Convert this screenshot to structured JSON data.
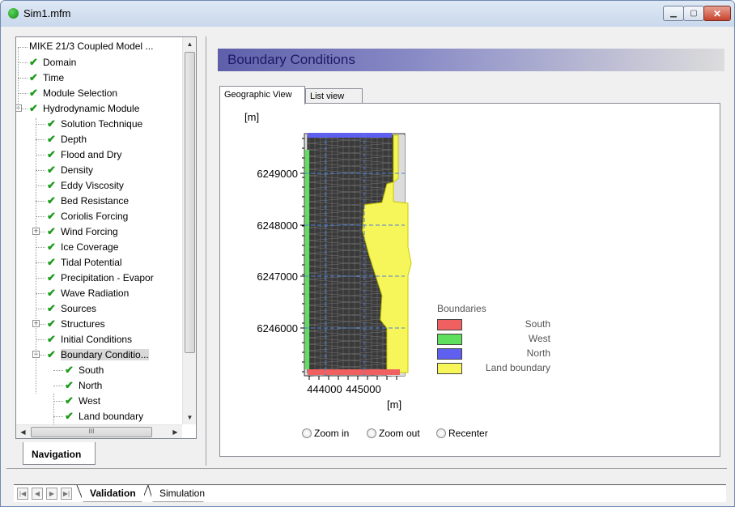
{
  "window": {
    "title": "Sim1.mfm",
    "min": "▁",
    "max": "▢",
    "close": "✕"
  },
  "tree": {
    "items": [
      {
        "label": "MIKE 21/3 Coupled Model ...",
        "level": 0,
        "check": false
      },
      {
        "label": "Domain",
        "level": 0,
        "check": true
      },
      {
        "label": "Time",
        "level": 0,
        "check": true
      },
      {
        "label": "Module Selection",
        "level": 0,
        "check": true
      },
      {
        "label": "Hydrodynamic Module",
        "level": 0,
        "check": true,
        "expander": "−"
      },
      {
        "label": "Solution Technique",
        "level": 1,
        "check": true
      },
      {
        "label": "Depth",
        "level": 1,
        "check": true
      },
      {
        "label": "Flood and Dry",
        "level": 1,
        "check": true
      },
      {
        "label": "Density",
        "level": 1,
        "check": true
      },
      {
        "label": "Eddy Viscosity",
        "level": 1,
        "check": true
      },
      {
        "label": "Bed Resistance",
        "level": 1,
        "check": true
      },
      {
        "label": "Coriolis Forcing",
        "level": 1,
        "check": true
      },
      {
        "label": "Wind Forcing",
        "level": 1,
        "check": true,
        "expander": "+"
      },
      {
        "label": "Ice Coverage",
        "level": 1,
        "check": true
      },
      {
        "label": "Tidal Potential",
        "level": 1,
        "check": true
      },
      {
        "label": "Precipitation - Evapor",
        "level": 1,
        "check": true
      },
      {
        "label": "Wave Radiation",
        "level": 1,
        "check": true
      },
      {
        "label": "Sources",
        "level": 1,
        "check": true
      },
      {
        "label": "Structures",
        "level": 1,
        "check": true,
        "expander": "+"
      },
      {
        "label": "Initial Conditions",
        "level": 1,
        "check": true
      },
      {
        "label": "Boundary Conditio...",
        "level": 1,
        "check": true,
        "expander": "−",
        "selected": true
      },
      {
        "label": "South",
        "level": 2,
        "check": true
      },
      {
        "label": "North",
        "level": 2,
        "check": true
      },
      {
        "label": "West",
        "level": 2,
        "check": true
      },
      {
        "label": "Land boundary",
        "level": 2,
        "check": true
      }
    ],
    "hthumb_label": "III"
  },
  "nav_tab": "Navigation",
  "panel_title": "Boundary Conditions",
  "tabs": {
    "geographic": "Geographic View",
    "list": "List view"
  },
  "map": {
    "y_unit": "[m]",
    "x_unit": "[m]",
    "y_ticks": [
      "6249000",
      "6248000",
      "6247000",
      "6246000"
    ],
    "x_ticks": [
      "444000",
      "445000"
    ]
  },
  "legend": {
    "title": "Boundaries",
    "items": [
      {
        "label": "South",
        "color": "#f06060"
      },
      {
        "label": "West",
        "color": "#5ee05e"
      },
      {
        "label": "North",
        "color": "#6060f0"
      },
      {
        "label": "Land boundary",
        "color": "#f6f65a"
      }
    ]
  },
  "zoom": {
    "zoom_in": "Zoom in",
    "zoom_out": "Zoom out",
    "recenter": "Recenter"
  },
  "sheets": {
    "validation": "Validation",
    "simulation": "Simulation"
  }
}
